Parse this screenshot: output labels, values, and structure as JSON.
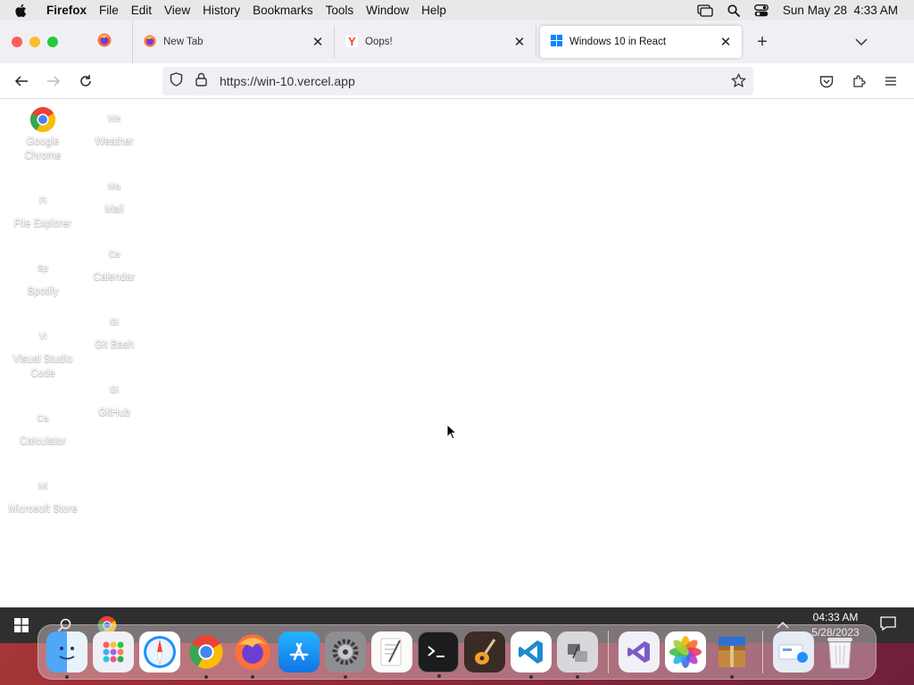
{
  "menubar": {
    "app_name": "Firefox",
    "items": [
      "File",
      "Edit",
      "View",
      "History",
      "Bookmarks",
      "Tools",
      "Window",
      "Help"
    ],
    "datetime": "Sun May 28  4:33 AM"
  },
  "tabs": {
    "items": [
      {
        "label": "New Tab"
      },
      {
        "label": "Oops!"
      },
      {
        "label": "Windows 10 in React"
      }
    ],
    "close_glyph": "✕",
    "new_tab_glyph": "+"
  },
  "navbar": {
    "url": "https://win-10.vercel.app"
  },
  "desktop": {
    "icons": [
      {
        "label": "Google Chrome",
        "glyph": ""
      },
      {
        "label": "Weather",
        "glyph": "We"
      },
      {
        "label": "File Explorer",
        "glyph": "Fi"
      },
      {
        "label": "Mail",
        "glyph": "Ma"
      },
      {
        "label": "Spotify",
        "glyph": "Sp"
      },
      {
        "label": "Calendar",
        "glyph": "Ca"
      },
      {
        "label": "Visual Studio Code",
        "glyph": "Vi"
      },
      {
        "label": "Git Bash",
        "glyph": "Gi"
      },
      {
        "label": "Calculator",
        "glyph": "Ca"
      },
      {
        "label": "GitHub",
        "glyph": "Gi"
      },
      {
        "label": "Microsoft Store",
        "glyph": "Mi"
      }
    ]
  },
  "win_taskbar": {
    "time": "04:33 AM",
    "date": "5/28/2023"
  },
  "dock": {
    "apps": [
      "finder",
      "launchpad",
      "safari",
      "chrome",
      "firefox",
      "app-store",
      "system-settings",
      "textedit",
      "terminal",
      "garageband",
      "vscode",
      "migration-assistant",
      "visual-studio",
      "photos",
      "winrar",
      "downloads",
      "trash"
    ]
  },
  "colors": {
    "menubar_bg": "#e9e7e7",
    "tabstrip_bg": "#f0f0f4",
    "taskbar_bg": "#2f2f2f",
    "chrome_red": "#ea4335",
    "chrome_green": "#34a853",
    "chrome_yellow": "#fbbc05",
    "chrome_blue": "#4285f4"
  }
}
